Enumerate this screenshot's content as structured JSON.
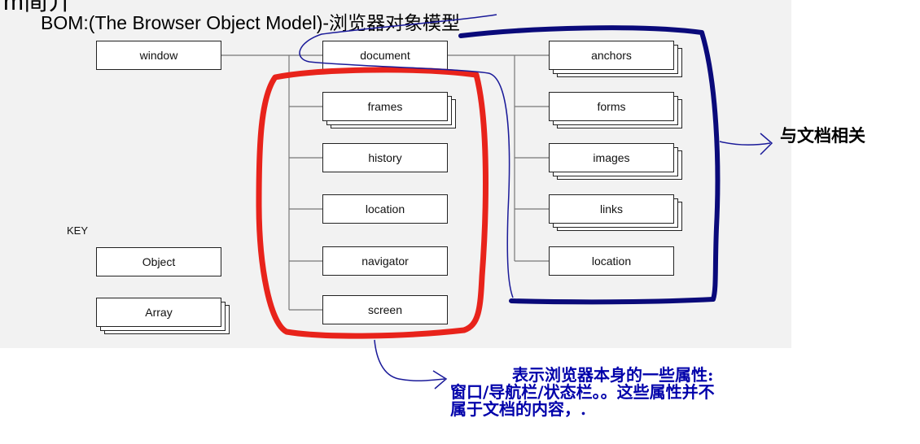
{
  "crop_text": "m简介",
  "title": "BOM:(The Browser Object Model)-浏览器对象模型",
  "root": {
    "label": "window"
  },
  "window_children": [
    {
      "label": "document",
      "stacked": false
    },
    {
      "label": "frames",
      "stacked": true
    },
    {
      "label": "history",
      "stacked": false
    },
    {
      "label": "location",
      "stacked": false
    },
    {
      "label": "navigator",
      "stacked": false
    },
    {
      "label": "screen",
      "stacked": false
    }
  ],
  "document_children": [
    {
      "label": "anchors",
      "stacked": true
    },
    {
      "label": "forms",
      "stacked": true
    },
    {
      "label": "images",
      "stacked": true
    },
    {
      "label": "links",
      "stacked": true
    },
    {
      "label": "location",
      "stacked": false
    }
  ],
  "key": {
    "heading": "KEY",
    "object_label": "Object",
    "array_label": "Array"
  },
  "annotations": {
    "document_related": "与文档相关",
    "browser_note_line1": "表示浏览器本身的一些属性:",
    "browser_note_line2": "窗口/导航栏/状态栏。。这些属性并不",
    "browser_note_line3": "属于文档的内容，."
  },
  "colors": {
    "red_marker": "#e8231b",
    "blue_marker": "#0a0a7a",
    "note_text": "#0000aa",
    "connector": "#777777"
  }
}
